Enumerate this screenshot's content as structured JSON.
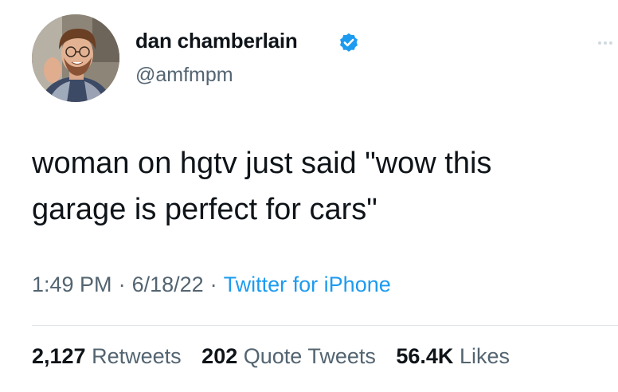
{
  "author": {
    "display_name": "dan chamberlain",
    "handle": "@amfmpm",
    "verified": true
  },
  "tweet": {
    "text_line1": "woman on hgtv just said \"wow this",
    "text_line2": "garage is perfect for cars\"",
    "time": "1:49 PM",
    "date": "6/18/22",
    "separator": "·",
    "source": "Twitter for iPhone"
  },
  "stats": {
    "retweets_count": "2,127",
    "retweets_label": "Retweets",
    "quotes_count": "202",
    "quotes_label": "Quote Tweets",
    "likes_count": "56.4K",
    "likes_label": "Likes"
  },
  "colors": {
    "link_blue": "#1d9bf0",
    "secondary_text": "#536471",
    "primary_text": "#0f1419"
  },
  "icons": {
    "verified": "verified-badge-icon",
    "more": "more-options-icon"
  }
}
